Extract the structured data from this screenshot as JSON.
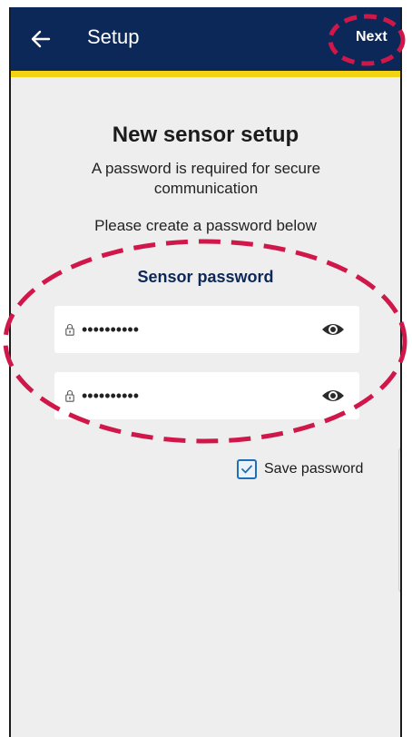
{
  "appbar": {
    "title": "Setup",
    "next_label": "Next",
    "color": "#0c2858",
    "accent": "#f2d414"
  },
  "main": {
    "heading": "New sensor setup",
    "subtitle": "A password is required for secure communication",
    "instruction": "Please create a password below",
    "section_label": "Sensor password",
    "password_field": {
      "value": "••••••••••"
    },
    "confirm_field": {
      "value": "••••••••••"
    },
    "save_password": {
      "label": "Save password",
      "checked": true
    }
  },
  "annotation_color": "#d0174a"
}
